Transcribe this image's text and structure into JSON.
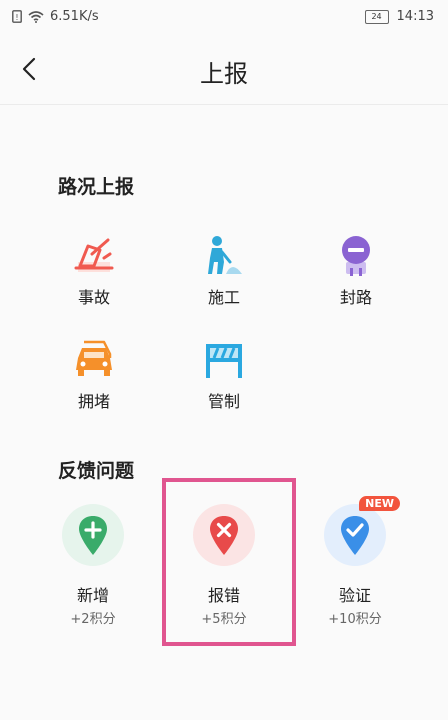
{
  "status": {
    "speed": "6.51K/s",
    "battery": "24",
    "time": "14:13"
  },
  "header": {
    "title": "上报"
  },
  "road": {
    "title": "路况上报",
    "items": [
      {
        "label": "事故",
        "icon": "accident-icon"
      },
      {
        "label": "施工",
        "icon": "construction-icon"
      },
      {
        "label": "封路",
        "icon": "road-closed-icon"
      },
      {
        "label": "拥堵",
        "icon": "congestion-icon"
      },
      {
        "label": "管制",
        "icon": "traffic-control-icon"
      }
    ]
  },
  "feedback": {
    "title": "反馈问题",
    "items": [
      {
        "label": "新增",
        "points": "+2积分",
        "icon": "add-location-icon"
      },
      {
        "label": "报错",
        "points": "+5积分",
        "icon": "error-location-icon"
      },
      {
        "label": "验证",
        "points": "+10积分",
        "icon": "verify-location-icon",
        "badge": "NEW"
      }
    ]
  },
  "colors": {
    "accident": "#f05a50",
    "construction": "#2fa8d8",
    "road_closed": "#8a63d2",
    "congestion": "#f5902a",
    "control": "#2aa8e0",
    "add": "#3aab6a",
    "error": "#e84a4a",
    "verify": "#3a8fe8",
    "highlight": "#e0558f"
  }
}
